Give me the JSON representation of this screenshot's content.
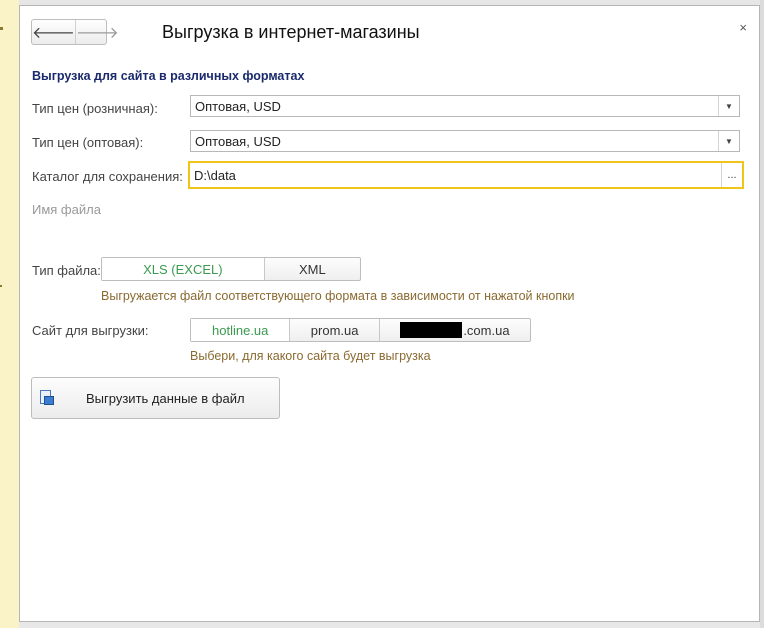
{
  "window": {
    "title": "Выгрузка в интернет-магазины",
    "back_icon": "arrow-left-icon",
    "forward_icon": "arrow-right-icon",
    "close_glyph": "×"
  },
  "section_title": "Выгрузка для сайта в различных форматах",
  "fields": {
    "retail_price": {
      "label": "Тип цен (розничная):",
      "value": "Оптовая, USD"
    },
    "wholesale_price": {
      "label": "Тип цен (оптовая):",
      "value": "Оптовая, USD"
    },
    "save_dir": {
      "label": "Каталог для сохранения:",
      "value": "D:\\data",
      "button": "..."
    }
  },
  "file_name_label": "Имя файла",
  "file_type": {
    "label": "Тип файла:",
    "options": [
      "XLS (EXCEL)",
      "XML"
    ],
    "selected": "XLS (EXCEL)",
    "note": "Выгружается файл соответствующего формата в зависимости от нажатой кнопки"
  },
  "site": {
    "label": "Сайт для выгрузки:",
    "options": [
      "hotline.ua",
      "prom.ua",
      ".com.ua"
    ],
    "selected": "hotline.ua",
    "note": "Выбери, для какого сайта будет выгрузка"
  },
  "export_button": {
    "label": "Выгрузить данные в файл",
    "icon": "excel-export-icon"
  },
  "colors": {
    "accent_green": "#3a9a50",
    "focus": "#f0c419",
    "section_title": "#1a2a6c",
    "note": "#8a6a30"
  }
}
